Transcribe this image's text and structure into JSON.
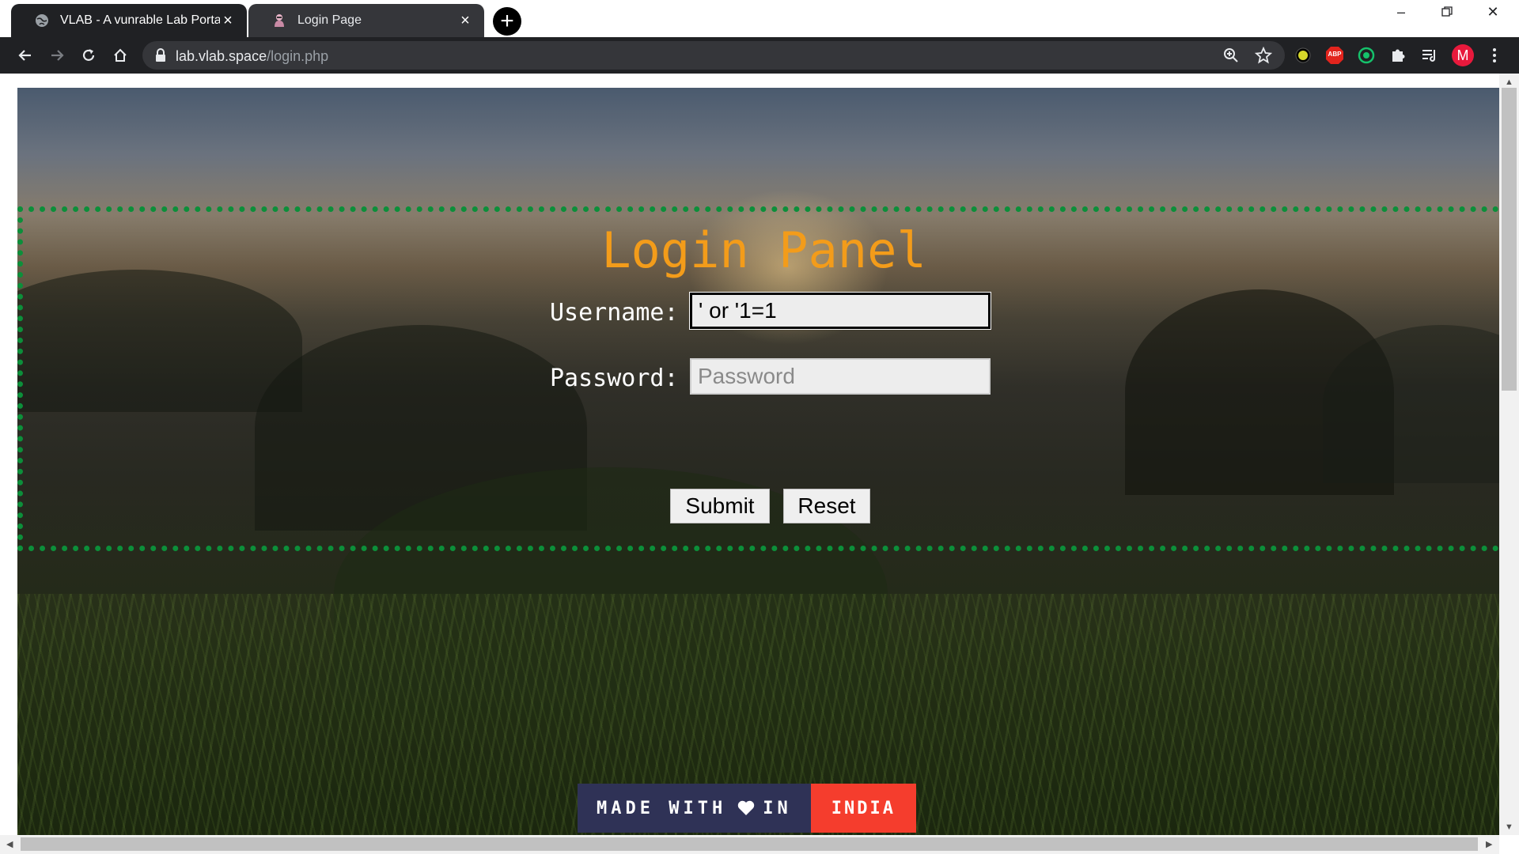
{
  "tabs": [
    {
      "title": "VLAB - A vunrable Lab Portal",
      "favicon": "globe-icon",
      "active": true
    },
    {
      "title": "Login Page",
      "favicon": "hacker-icon",
      "active": false
    }
  ],
  "address_bar": {
    "domain": "lab.vlab.space",
    "path": "/login.php"
  },
  "profile_initial": "M",
  "extensions": [
    "moon-extension-icon",
    "adblock-extension-icon",
    "grammar-extension-icon",
    "puzzle-extensions-icon",
    "reading-list-icon"
  ],
  "abp_label": "ABP",
  "login": {
    "title": "Login Panel",
    "username_label": "Username:",
    "username_value": "' or '1=1",
    "password_label": "Password:",
    "password_placeholder": "Password",
    "submit_label": "Submit",
    "reset_label": "Reset"
  },
  "footer_badge": {
    "left_text_1": "MADE WITH",
    "left_text_2": "IN",
    "right_text": "INDIA"
  },
  "colors": {
    "title": "#f39c1a",
    "panel_border": "#0c8f3a",
    "badge_left": "#2f3256",
    "badge_right": "#f53d2d"
  }
}
